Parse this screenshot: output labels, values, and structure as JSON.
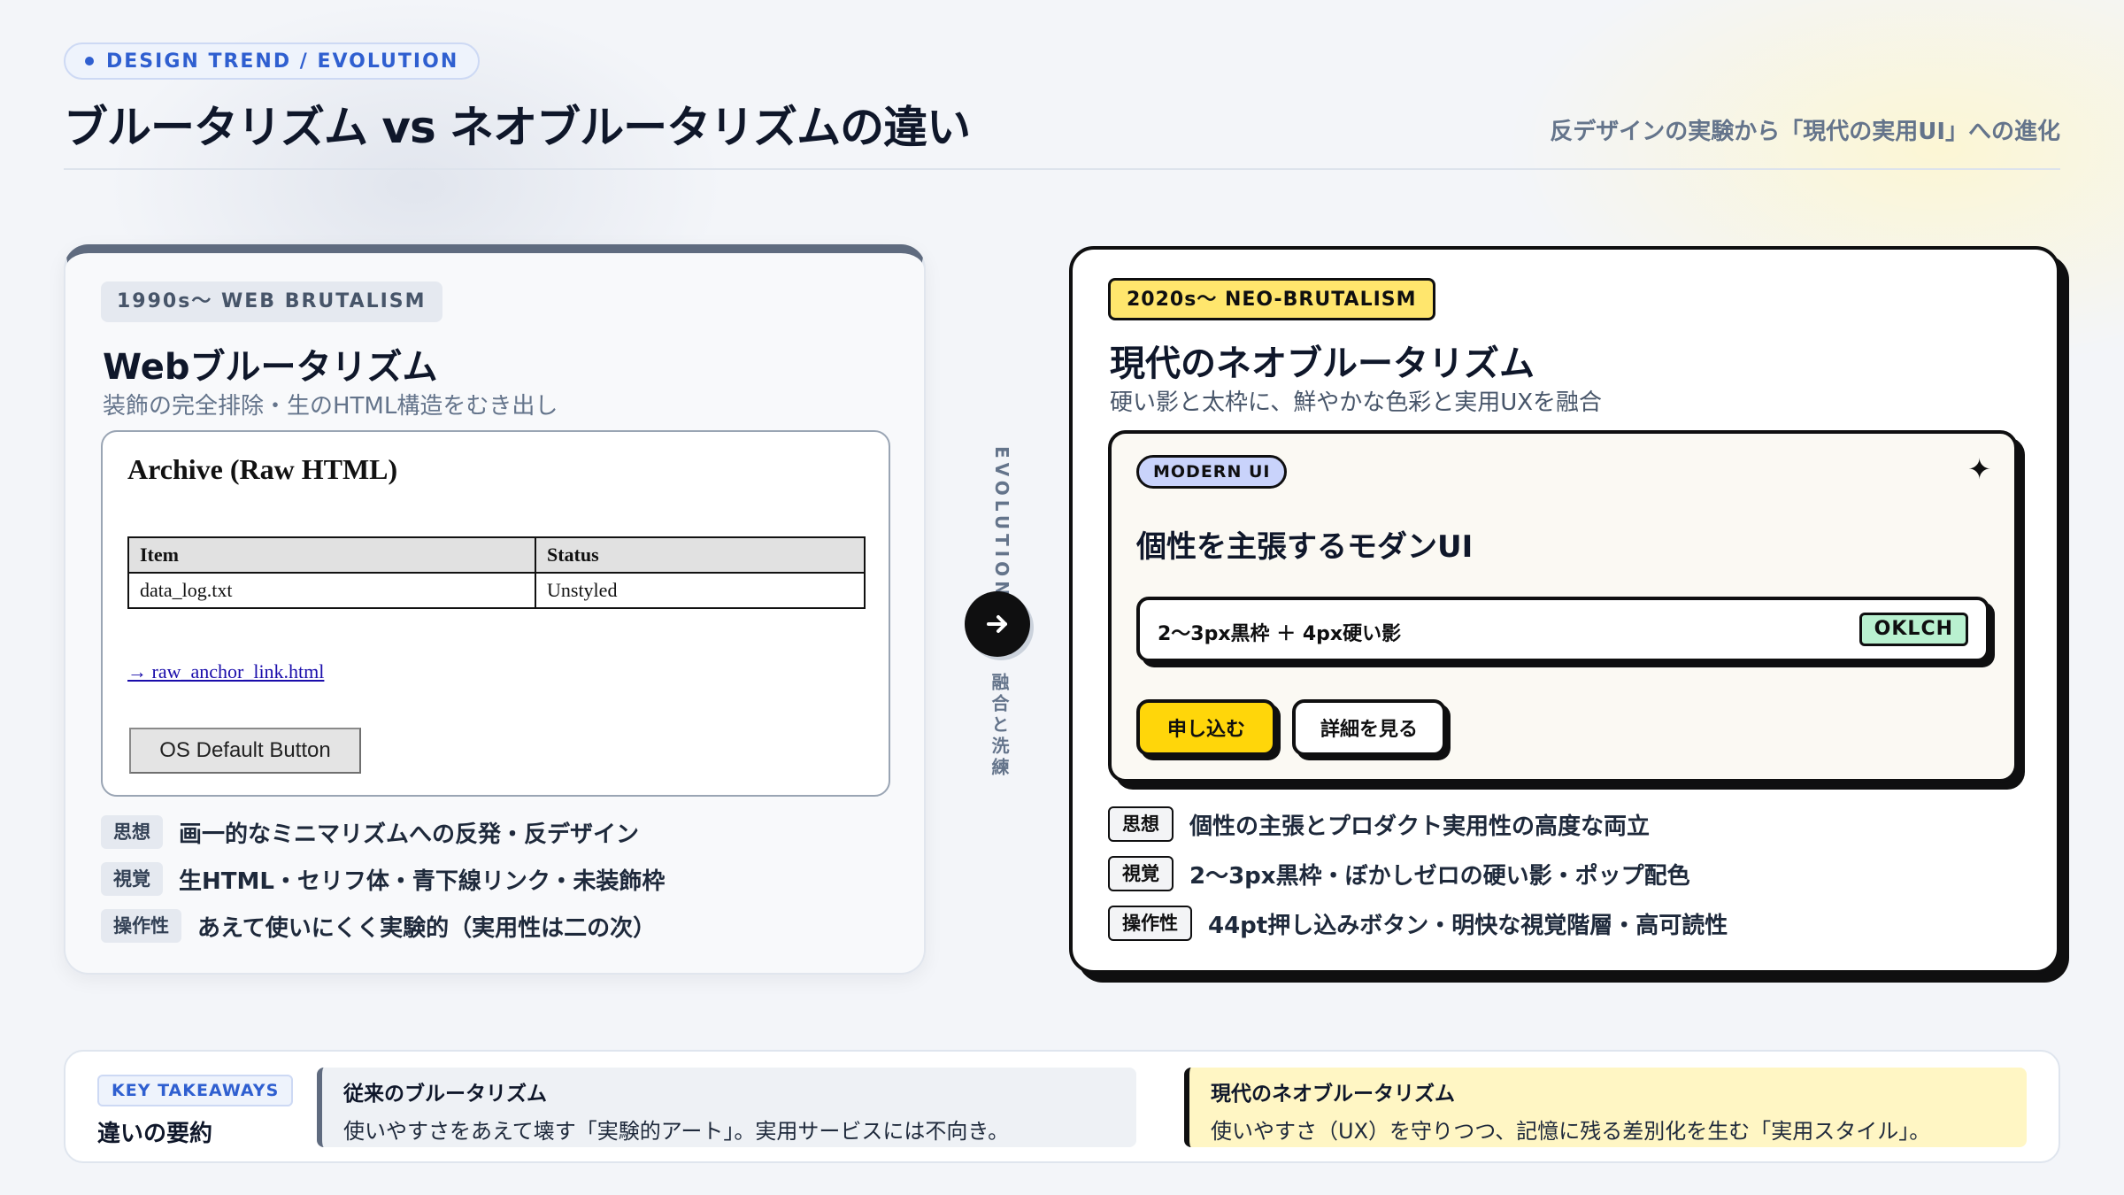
{
  "colors": {
    "accent_blue": "#2f5fd0",
    "neo_yellow": "#ffd60a",
    "tag_yellow": "#ffe66d",
    "ink_black": "#0f0f10",
    "slate": "#5f6b7f",
    "modern_pill_blue": "#c9d3fb",
    "oklch_green": "#b9f1d0"
  },
  "header": {
    "pill": "DESIGN TREND / EVOLUTION",
    "title": "ブルータリズム vs ネオブルータリズムの違い",
    "subtitle": "反デザインの実験から「現代の実用UI」への進化"
  },
  "left_card": {
    "tag": "1990s〜 WEB BRUTALISM",
    "title": "Webブルータリズム",
    "subtitle": "装飾の完全排除・生のHTML構造をむき出し",
    "raw_demo": {
      "heading": "Archive (Raw HTML)",
      "table_headers": [
        "Item",
        "Status"
      ],
      "table_rows": [
        [
          "data_log.txt",
          "Unstyled"
        ]
      ],
      "link_text": "→ raw_anchor_link.html",
      "button_label": "OS Default Button"
    },
    "features": [
      {
        "label": "思想",
        "text": "画一的なミニマリズムへの反発・反デザイン"
      },
      {
        "label": "視覚",
        "text": "生HTML・セリフ体・青下線リンク・未装飾枠"
      },
      {
        "label": "操作性",
        "text": "あえて使いにくく実験的（実用性は二の次）"
      }
    ]
  },
  "connector": {
    "top_label": "EVOLUTION",
    "icon": "arrow-right-icon",
    "bottom_label": "融合と洗練"
  },
  "right_card": {
    "tag": "2020s〜 NEO-BRUTALISM",
    "title": "現代のネオブルータリズム",
    "subtitle": "硬い影と太枠に、鮮やかな色彩と実用UXを融合",
    "modern_demo": {
      "pill": "MODERN UI",
      "icon": "sparkle-icon",
      "heading": "個性を主張するモダンUI",
      "field_text": "2〜3px黒枠 ＋ 4px硬い影",
      "badge": "OKLCH",
      "primary_button": "申し込む",
      "secondary_button": "詳細を見る"
    },
    "features": [
      {
        "label": "思想",
        "text": "個性の主張とプロダクト実用性の高度な両立"
      },
      {
        "label": "視覚",
        "text": "2〜3px黒枠・ぼかしゼロの硬い影・ポップ配色"
      },
      {
        "label": "操作性",
        "text": "44pt押し込みボタン・明快な視覚階層・高可読性"
      }
    ]
  },
  "takeaways": {
    "pill": "KEY TAKEAWAYS",
    "title": "違いの要約",
    "old": {
      "heading": "従来のブルータリズム",
      "body": "使いやすさをあえて壊す「実験的アート」。実用サービスには不向き。"
    },
    "new": {
      "heading": "現代のネオブルータリズム",
      "body": "使いやすさ（UX）を守りつつ、記憶に残る差別化を生む「実用スタイル」。"
    }
  }
}
